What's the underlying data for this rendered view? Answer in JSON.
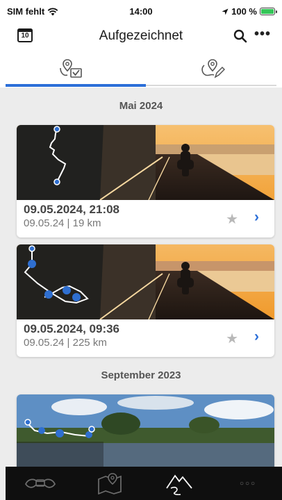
{
  "status": {
    "carrier": "SIM fehlt",
    "time": "14:00",
    "battery": "100 %"
  },
  "nav": {
    "title": "Aufgezeichnet",
    "calendar_day": "10",
    "more_label": "•••"
  },
  "tabs": [
    {
      "name": "recorded",
      "active": true
    },
    {
      "name": "planned",
      "active": false
    }
  ],
  "sections": [
    {
      "header": "Mai 2024",
      "trips": [
        {
          "date": "09.05.2024, 21:08",
          "sub": "09.05.24 | 19 km"
        },
        {
          "date": "09.05.2024, 09:36",
          "sub": "09.05.24 | 225 km"
        }
      ]
    },
    {
      "header": "September 2023",
      "trips": []
    }
  ],
  "icons": {
    "star": "★",
    "chevron": "›"
  },
  "colors": {
    "accent": "#2c6fd8",
    "star": "#b8b8b8"
  },
  "bottom_nav": [
    "connected-ride-icon",
    "map-icon",
    "mountain-route-icon",
    "more-icon"
  ],
  "bottom_nav_more": "○○○"
}
